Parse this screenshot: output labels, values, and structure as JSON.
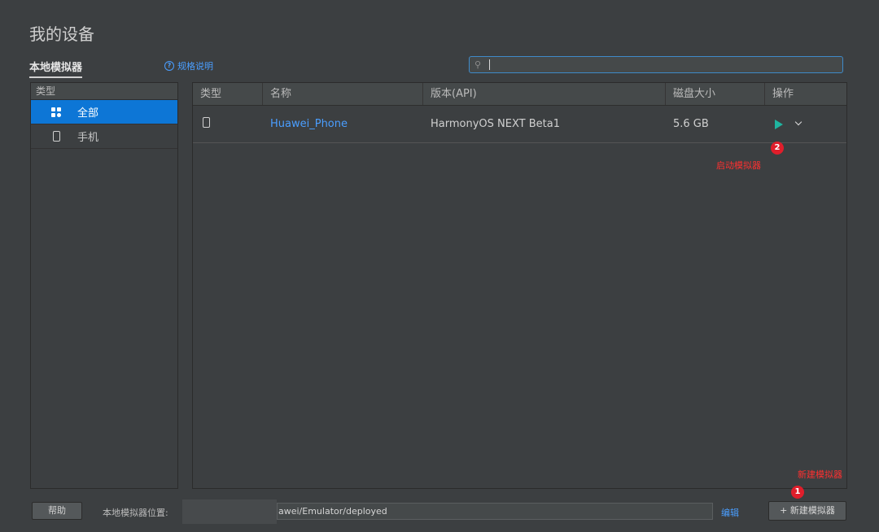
{
  "page": {
    "title": "我的设备"
  },
  "tabs": {
    "local_emulator": "本地模拟器",
    "help_link": "规格说明"
  },
  "search": {
    "icon": "search-icon",
    "value": ""
  },
  "categories": {
    "header": "类型",
    "items": [
      {
        "label": "全部",
        "icon": "grid-icon",
        "active": true
      },
      {
        "label": "手机",
        "icon": "phone-icon",
        "active": false
      }
    ]
  },
  "table": {
    "columns": [
      "类型",
      "名称",
      "版本(API)",
      "磁盘大小",
      "操作"
    ],
    "rows": [
      {
        "type_icon": "phone-icon",
        "name": "Huawei_Phone",
        "version": "HarmonyOS NEXT Beta1",
        "disk": "5.6 GB",
        "actions": [
          "play-icon",
          "chevron-down-icon"
        ]
      }
    ]
  },
  "annotations": {
    "start": {
      "number": "2",
      "text": "启动模拟器"
    },
    "create": {
      "number": "1",
      "text": "新建模拟器"
    }
  },
  "footer": {
    "help_button": "帮助",
    "location_label": "本地模拟器位置:",
    "location_path": "awei/Emulator/deployed",
    "edit_link": "编辑",
    "new_button": "+ 新建模拟器"
  },
  "colors": {
    "accent": "#0d76d6",
    "link": "#4a9eff",
    "play": "#1fb5a0",
    "annotation": "#e01e2b"
  }
}
